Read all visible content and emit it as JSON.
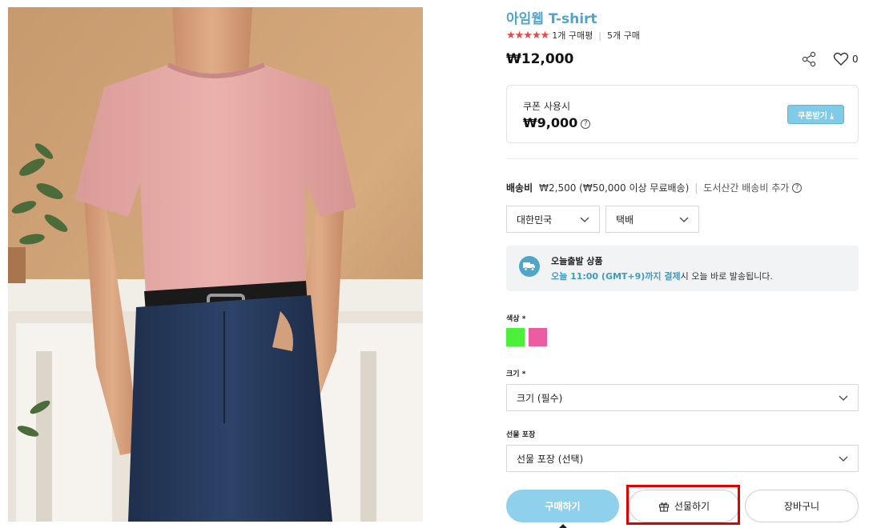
{
  "product": {
    "title": "아임웹 T-shirt",
    "stars": "★★★★★",
    "review_count": "1개 구매평",
    "purchase_count": "5개 구매",
    "price": "₩12,000",
    "like_count": "0",
    "rating_color": "#ef4444",
    "accent_color": "#4fa6c9"
  },
  "coupon": {
    "label": "쿠폰 사용시",
    "price": "₩9,000",
    "help_glyph": "?",
    "button_label": "쿠폰받기 ⤓"
  },
  "shipping": {
    "label": "배송비",
    "detail": "₩2,500 (₩50,000 이상 무료배송)",
    "sep": "|",
    "note": "도서산간 배송비 추가",
    "help_glyph": "?",
    "country_select": "대한민국",
    "method_select": "택배"
  },
  "notice": {
    "title": "오늘출발 상품",
    "highlight": "오늘 11:00 (GMT+9)까지 결제",
    "text": "시 오늘 바로 발송됩니다."
  },
  "options": {
    "color_label": "색상 *",
    "colors": [
      "#4cf03b",
      "#ec5ca3"
    ],
    "size_label": "크기 *",
    "size_placeholder": "크기 (필수)",
    "gift_label": "선물 포장",
    "gift_placeholder": "선물 포장 (선택)"
  },
  "actions": {
    "buy": "구매하기",
    "gift": "선물하기",
    "cart": "장바구니"
  }
}
